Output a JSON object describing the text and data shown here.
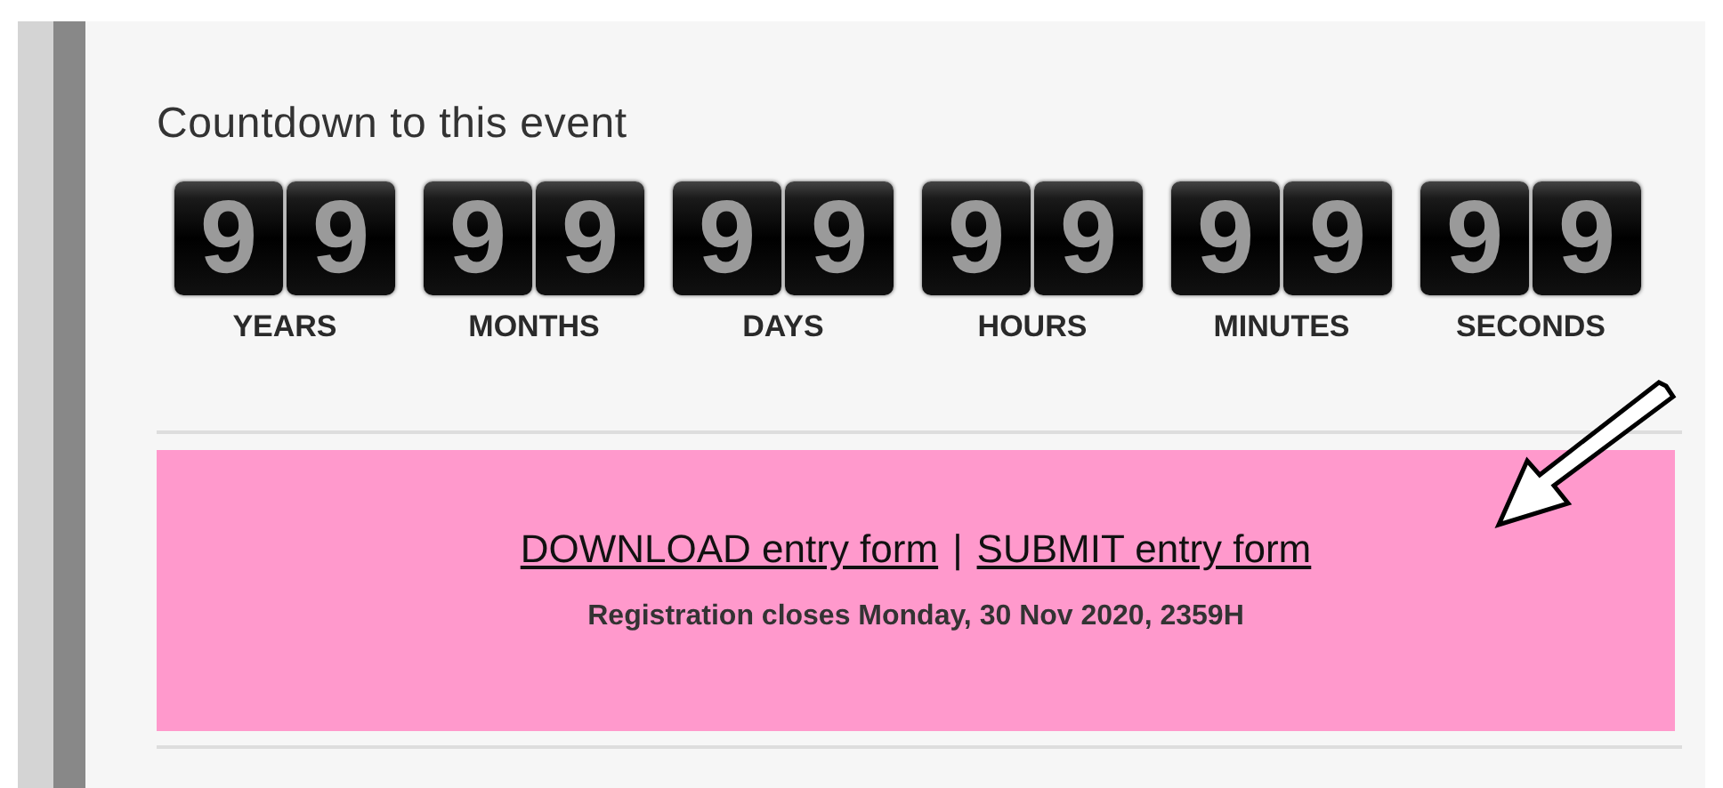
{
  "countdown": {
    "title": "Countdown to this event",
    "units": [
      {
        "digits": [
          "9",
          "9"
        ],
        "label": "YEARS"
      },
      {
        "digits": [
          "9",
          "9"
        ],
        "label": "MONTHS"
      },
      {
        "digits": [
          "9",
          "9"
        ],
        "label": "DAYS"
      },
      {
        "digits": [
          "9",
          "9"
        ],
        "label": "HOURS"
      },
      {
        "digits": [
          "9",
          "9"
        ],
        "label": "MINUTES"
      },
      {
        "digits": [
          "9",
          "9"
        ],
        "label": "SECONDS"
      }
    ]
  },
  "registration": {
    "links": [
      "DOWNLOAD entry form",
      "SUBMIT entry form"
    ],
    "separator": "|",
    "note": "Registration closes Monday, 30 Nov 2020, 2359H"
  }
}
